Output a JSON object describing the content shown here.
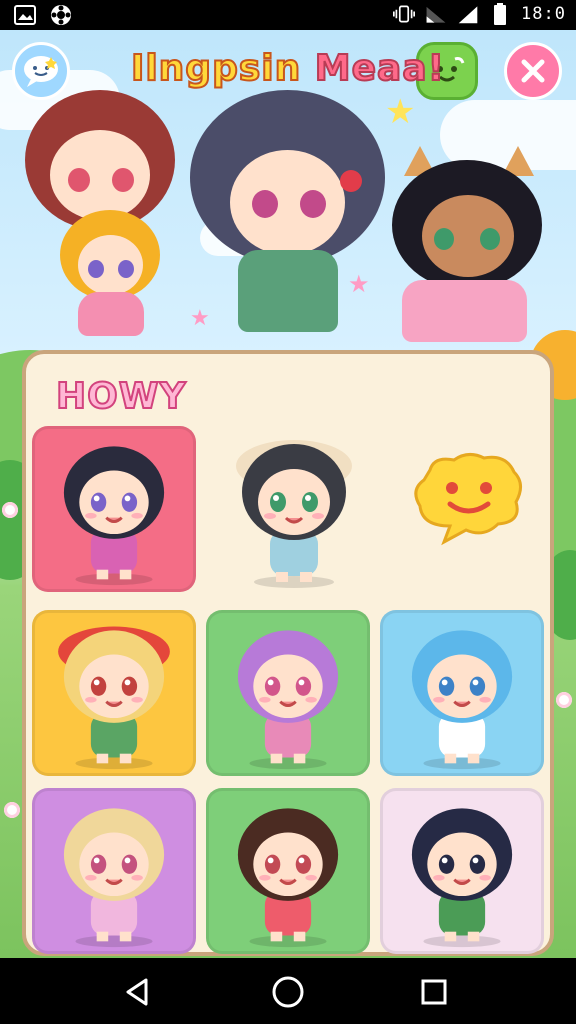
{
  "status_bar": {
    "time": "18:0",
    "icons": [
      "image-icon",
      "pinwheel-icon",
      "vibrate-icon",
      "wifi-icon",
      "signal-icon",
      "battery-icon"
    ]
  },
  "header": {
    "title_part1": "Ilngpsin",
    "title_part2": "Meaa!",
    "left_button_icon": "chat-bubble-icon",
    "right_button_icon": "green-face-icon",
    "close_button_icon": "close-icon"
  },
  "panel": {
    "title": "HOWY",
    "cards": [
      {
        "id": "c1",
        "bg": "#f46d86",
        "hair": "#2a2b3d",
        "eyes": "#7a63c9",
        "outfit": "#d962b3"
      },
      {
        "id": "c2",
        "bg": "transparent",
        "hair": "#3a3c44",
        "eyes": "#3f9a6a",
        "outfit": "#9fd0e0",
        "hat": "#f1dfc2"
      },
      {
        "id": "c3",
        "bg": "transparent",
        "bubble": "#ffd63a"
      },
      {
        "id": "c4",
        "bg": "#fdc640",
        "hair": "#f4d47a",
        "eyes": "#c2423e",
        "outfit": "#5aa564",
        "hat": "#e4463b"
      },
      {
        "id": "c5",
        "bg": "#7ecf79",
        "hair": "#b77ad8",
        "eyes": "#d2568b",
        "outfit": "#e88ab8"
      },
      {
        "id": "c6",
        "bg": "#8ad4f3",
        "hair": "#5cb7ea",
        "eyes": "#3d82c7",
        "outfit": "#ffffff"
      },
      {
        "id": "c7",
        "bg": "#cf8ee1",
        "hair": "#f0d79a",
        "eyes": "#c4527e",
        "outfit": "#f1b7de"
      },
      {
        "id": "c8",
        "bg": "#7ecf79",
        "hair": "#4b2b22",
        "eyes": "#c24a55",
        "outfit": "#ee5c6b"
      },
      {
        "id": "c9",
        "bg": "#f6e1ef",
        "hair": "#262a45",
        "eyes": "#262a45",
        "outfit": "#4b9c56"
      }
    ]
  },
  "colors": {
    "panel_bg": "#fbf1dc",
    "panel_border": "#c9a57c",
    "accent_pink": "#ff7aa8",
    "accent_green": "#7cd24e"
  },
  "nav": {
    "back_icon": "back-triangle-icon",
    "home_icon": "home-circle-icon",
    "recents_icon": "recents-square-icon"
  }
}
